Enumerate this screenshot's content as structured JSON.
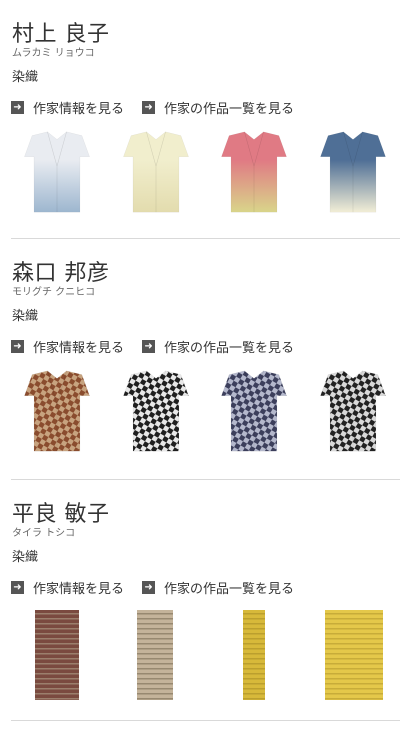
{
  "artists": [
    {
      "name": "村上 良子",
      "kana": "ムラカミ リョウコ",
      "genre": "染織",
      "link_info": "作家情報を見る",
      "link_works": "作家の作品一覧を見る",
      "works": [
        {
          "type": "kimono",
          "colors": [
            "#e9ecf1",
            "#9db6cf"
          ]
        },
        {
          "type": "kimono",
          "colors": [
            "#f1eecd",
            "#e3dcae"
          ]
        },
        {
          "type": "kimono",
          "colors": [
            "#e07a84",
            "#d9d58a"
          ]
        },
        {
          "type": "kimono",
          "colors": [
            "#4f6f96",
            "#f2eed6"
          ]
        }
      ]
    },
    {
      "name": "森口 邦彦",
      "kana": "モリグチ クニヒコ",
      "genre": "染織",
      "link_info": "作家情報を見る",
      "link_works": "作家の作品一覧を見る",
      "works": [
        {
          "type": "kimono",
          "colors": [
            "#8a4c2e",
            "#c7a37f"
          ]
        },
        {
          "type": "kimono",
          "colors": [
            "#1f1f1f",
            "#e8e8e8"
          ]
        },
        {
          "type": "kimono",
          "colors": [
            "#3c3f5c",
            "#b4b8cc"
          ]
        },
        {
          "type": "kimono",
          "colors": [
            "#222222",
            "#d9d9d9"
          ]
        }
      ]
    },
    {
      "name": "平良 敏子",
      "kana": "タイラ トシコ",
      "genre": "染織",
      "link_info": "作家情報を見る",
      "link_works": "作家の作品一覧を見る",
      "works": [
        {
          "type": "bolt",
          "colors": [
            "#7a4a3f",
            "#b0a48a"
          ]
        },
        {
          "type": "bolt",
          "colors": [
            "#c4b39a",
            "#7a6a55"
          ]
        },
        {
          "type": "bolt",
          "colors": [
            "#d7b93a",
            "#a98d26"
          ]
        },
        {
          "type": "bolt",
          "colors": [
            "#e4c84a",
            "#b49a2e"
          ]
        }
      ]
    }
  ]
}
